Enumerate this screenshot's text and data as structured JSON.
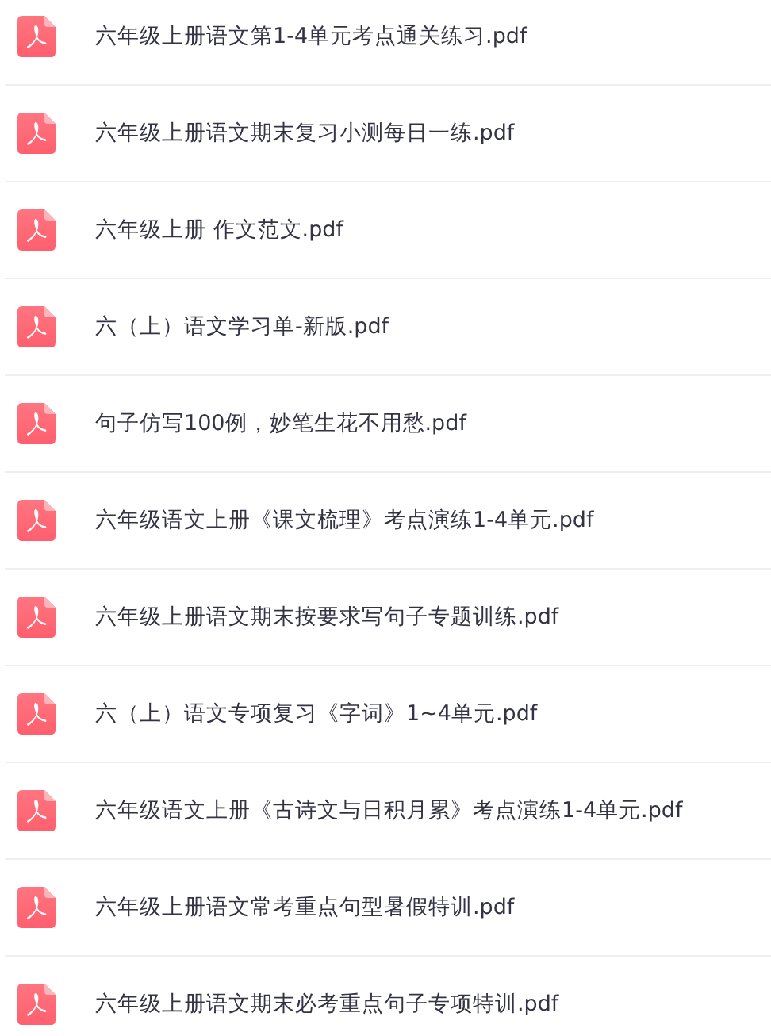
{
  "files": [
    {
      "name": "六年级上册语文第1-4单元考点通关练习.pdf"
    },
    {
      "name": "六年级上册语文期末复习小测每日一练.pdf"
    },
    {
      "name": "六年级上册 作文范文.pdf"
    },
    {
      "name": "六（上）语文学习单-新版.pdf"
    },
    {
      "name": "句子仿写100例，妙笔生花不用愁.pdf"
    },
    {
      "name": "六年级语文上册《课文梳理》考点演练1-4单元.pdf"
    },
    {
      "name": "六年级上册语文期末按要求写句子专题训练.pdf"
    },
    {
      "name": "六（上）语文专项复习《字词》1~4单元.pdf"
    },
    {
      "name": "六年级语文上册《古诗文与日积月累》考点演练1-4单元.pdf"
    },
    {
      "name": "六年级上册语文常考重点句型暑假特训.pdf"
    },
    {
      "name": "六年级上册语文期末必考重点句子专项特训.pdf"
    }
  ]
}
